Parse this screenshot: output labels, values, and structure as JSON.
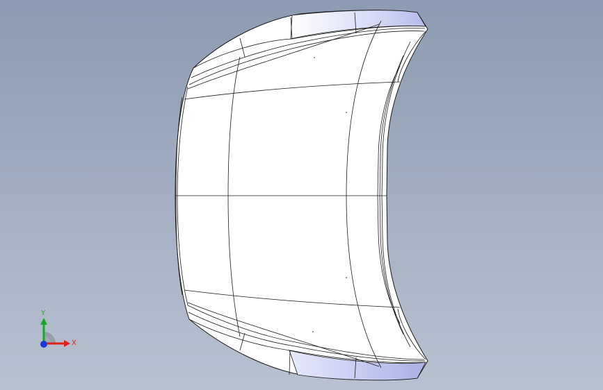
{
  "view": {
    "model": "hood-panel-surface",
    "display_mode": "shaded-with-edges",
    "background_gradient": [
      "#8c9bb1",
      "#b8c1d0"
    ]
  },
  "triad": {
    "x_label": "X",
    "y_label": "Y",
    "x_color": "#e0201a",
    "y_color": "#1aa626",
    "z_color": "#1a3ad6"
  }
}
